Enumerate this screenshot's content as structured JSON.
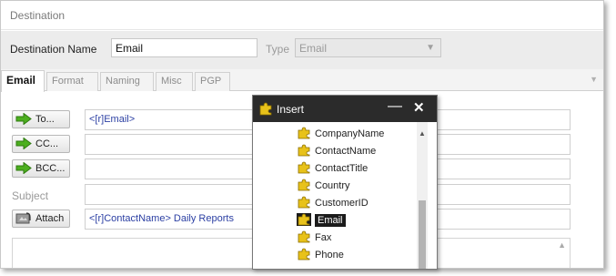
{
  "window": {
    "title": "Destination"
  },
  "destination": {
    "name_label": "Destination Name",
    "name_value": "Email",
    "type_label": "Type",
    "type_value": "Email"
  },
  "tabs": [
    {
      "label": "Email",
      "active": true
    },
    {
      "label": "Format"
    },
    {
      "label": "Naming"
    },
    {
      "label": "Misc"
    },
    {
      "label": "PGP"
    }
  ],
  "email_form": {
    "to_label": "To...",
    "to_value": "<[r]Email>",
    "cc_label": "CC...",
    "cc_value": "",
    "bcc_label": "BCC...",
    "bcc_value": "",
    "subject_label": "Subject",
    "subject_value": "",
    "attach_label": "Attach",
    "attach_value": "<[r]ContactName> Daily Reports"
  },
  "insert_popup": {
    "title": "Insert",
    "minimize": "—",
    "close": "✕",
    "items": [
      {
        "label": "CompanyName"
      },
      {
        "label": "ContactName"
      },
      {
        "label": "ContactTitle"
      },
      {
        "label": "Country"
      },
      {
        "label": "CustomerID"
      },
      {
        "label": "Email",
        "selected": true
      },
      {
        "label": "Fax"
      },
      {
        "label": "Phone"
      }
    ]
  },
  "colors": {
    "accent_green": "#4caf1f",
    "field_text_blue": "#2b3fa3",
    "popup_header": "#2b2b2b",
    "puzzle_yellow": "#e8c21a"
  },
  "icons": {
    "arrow": "green-arrow-icon",
    "attach": "attach-icon",
    "puzzle": "puzzle-icon"
  }
}
